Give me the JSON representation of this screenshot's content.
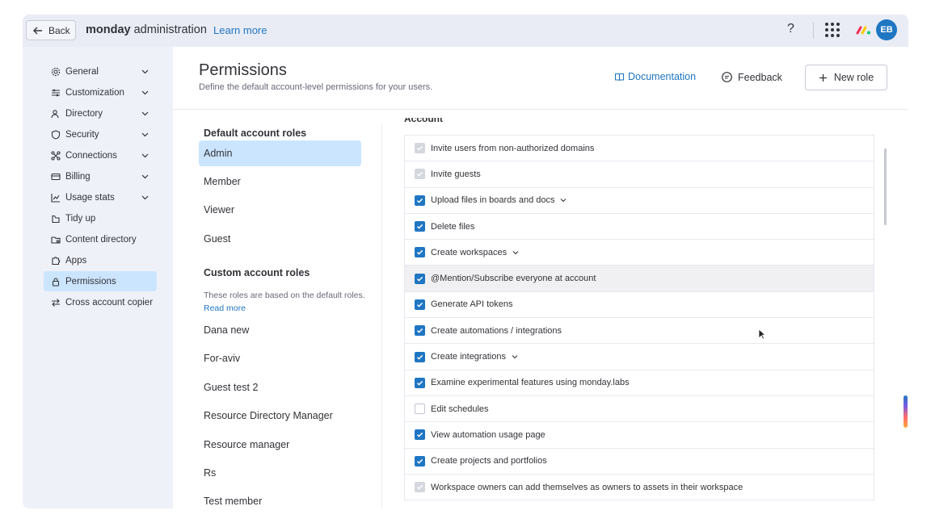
{
  "topbar": {
    "back_label": "Back",
    "brand_bold": "monday",
    "brand_rest": " administration",
    "learn_more": "Learn more",
    "help_label": "?",
    "avatar_initials": "EB"
  },
  "sidebar": {
    "items": [
      {
        "label": "General",
        "icon": "gear-icon",
        "expandable": true
      },
      {
        "label": "Customization",
        "icon": "sliders-icon",
        "expandable": true
      },
      {
        "label": "Directory",
        "icon": "users-icon",
        "expandable": true
      },
      {
        "label": "Security",
        "icon": "shield-icon",
        "expandable": true
      },
      {
        "label": "Connections",
        "icon": "connections-icon",
        "expandable": true
      },
      {
        "label": "Billing",
        "icon": "card-icon",
        "expandable": true
      },
      {
        "label": "Usage stats",
        "icon": "chart-icon",
        "expandable": true
      },
      {
        "label": "Tidy up",
        "icon": "broom-icon",
        "expandable": false
      },
      {
        "label": "Content directory",
        "icon": "folder-icon",
        "expandable": false
      },
      {
        "label": "Apps",
        "icon": "puzzle-icon",
        "expandable": false
      },
      {
        "label": "Permissions",
        "icon": "lock-icon",
        "expandable": false,
        "active": true
      },
      {
        "label": "Cross account copier",
        "icon": "swap-icon",
        "expandable": false
      }
    ]
  },
  "header": {
    "title": "Permissions",
    "subtitle": "Define the default account-level permissions for your users.",
    "documentation": "Documentation",
    "feedback": "Feedback",
    "new_role": "New role"
  },
  "roles": {
    "default_heading": "Default account roles",
    "default": [
      "Admin",
      "Member",
      "Viewer",
      "Guest"
    ],
    "selected": "Admin",
    "custom_heading": "Custom account roles",
    "custom_desc": "These roles are based on the default roles.",
    "read_more": "Read more",
    "custom": [
      "Dana new",
      "For-aviv",
      "Guest test 2",
      "Resource Directory Manager",
      "Resource manager",
      "Rs",
      "Test member"
    ]
  },
  "permissions": {
    "section_heading": "Account",
    "items": [
      {
        "label": "Invite users from non-authorized domains",
        "state": "disabled-checked",
        "chevron": false
      },
      {
        "label": "Invite guests",
        "state": "disabled-checked",
        "chevron": false
      },
      {
        "label": "Upload files in boards and docs",
        "state": "checked",
        "chevron": true
      },
      {
        "label": "Delete files",
        "state": "checked",
        "chevron": false
      },
      {
        "label": "Create workspaces",
        "state": "checked",
        "chevron": true
      },
      {
        "label": "@Mention/Subscribe everyone at account",
        "state": "checked",
        "chevron": false,
        "hover": true
      },
      {
        "label": "Generate API tokens",
        "state": "checked",
        "chevron": false
      },
      {
        "label": "Create automations / integrations",
        "state": "checked",
        "chevron": false
      },
      {
        "label": "Create integrations",
        "state": "checked",
        "chevron": true
      },
      {
        "label": "Examine experimental features using monday.labs",
        "state": "checked",
        "chevron": false
      },
      {
        "label": "Edit schedules",
        "state": "unchecked",
        "chevron": false
      },
      {
        "label": "View automation usage page",
        "state": "checked",
        "chevron": false
      },
      {
        "label": "Create projects and portfolios",
        "state": "checked",
        "chevron": false
      },
      {
        "label": "Workspace owners can add themselves as owners to assets in their workspace",
        "state": "disabled-checked",
        "chevron": false
      }
    ]
  },
  "colors": {
    "accent": "#1f76c2",
    "active_bg": "#cce5ff",
    "sidebar_bg": "#eef1f8"
  }
}
